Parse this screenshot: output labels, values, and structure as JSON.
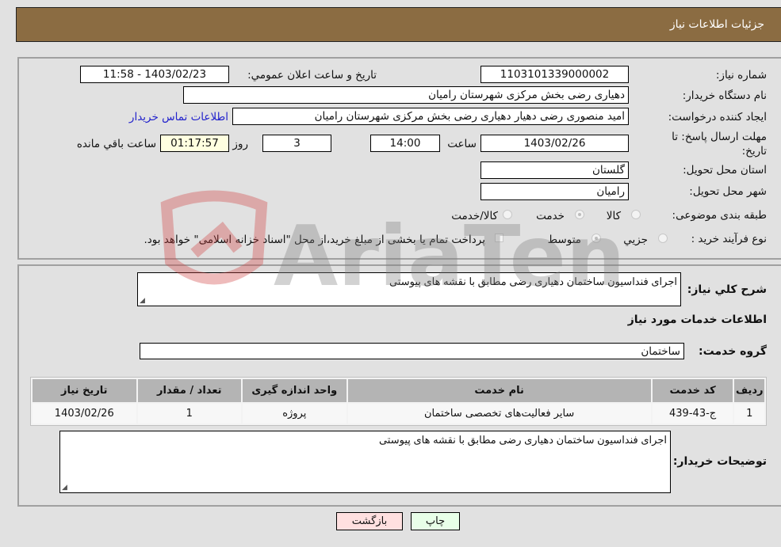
{
  "header": {
    "title": "جزئیات اطلاعات نیاز"
  },
  "details": {
    "need_number_label": "شماره نیاز:",
    "need_number": "1103101339000002",
    "announce_label": "تاریخ و ساعت اعلان عمومي:",
    "announce_value": "1403/02/23 - 11:58",
    "buyer_org_label": "نام دستگاه خريدار:",
    "buyer_org": "دهیاری رضی بخش مرکزی شهرستان رامیان",
    "creator_label": "ایجاد کننده درخواست:",
    "creator": "امید منصوری رضی دهیار دهیاری رضی بخش مرکزی شهرستان رامیان",
    "contact_link": "اطلاعات تماس خریدار",
    "deadline_label_line1": "مهلت ارسال پاسخ: تا",
    "deadline_label_line2": "تاریخ:",
    "deadline_date": "1403/02/26",
    "time_label": "ساعت",
    "deadline_time": "14:00",
    "days_value": "3",
    "days_label": "روز و",
    "remaining_time": "01:17:57",
    "remaining_label": "ساعت باقي مانده",
    "province_label": "استان محل تحویل:",
    "province": "گلستان",
    "city_label": "شهر محل تحویل:",
    "city": "رامیان",
    "category_label": "طبقه بندی موضوعی:",
    "category_options": [
      {
        "label": "کالا",
        "selected": false
      },
      {
        "label": "خدمت",
        "selected": true
      },
      {
        "label": "کالا/خدمت",
        "selected": false
      }
    ],
    "process_label": "نوع فرآیند خرید :",
    "process_options": [
      {
        "label": "جزيي",
        "selected": false
      },
      {
        "label": "متوسط",
        "selected": true
      }
    ],
    "treasury_note": "پرداخت تمام يا بخشی از مبلغ خرید،از محل \"اسناد خزانه اسلامی\" خواهد بود.",
    "treasury_checked": false
  },
  "services": {
    "description_label": "شرح کلي نياز:",
    "description": "اجرای فنداسیون ساختمان دهیاری رضی مطابق با نقشه های پیوستی",
    "section_title": "اطلاعات خدمات مورد نیاز",
    "group_label": "گروه خدمت:",
    "group_value": "ساختمان",
    "table": {
      "headers": [
        "ردیف",
        "کد خدمت",
        "نام خدمت",
        "واحد اندازه گیری",
        "تعداد / مقدار",
        "تاریخ نیاز"
      ],
      "rows": [
        [
          "1",
          "ج-43-439",
          "سایر فعالیت‌های تخصصی ساختمان",
          "پروژه",
          "1",
          "1403/02/26"
        ]
      ]
    },
    "buyer_notes_label": "توضیحات خریدار:",
    "buyer_notes": "اجرای فنداسیون ساختمان دهیاری رضی مطابق با نقشه های پیوستی"
  },
  "buttons": {
    "print": "چاپ",
    "back": "بازگشت"
  },
  "colors": {
    "header": "#8b6c42",
    "back_button": "#ffe0e0",
    "print_button": "#e8ffe8",
    "link": "#2222cc"
  },
  "watermark": {
    "text": "AriaTender.neT"
  }
}
